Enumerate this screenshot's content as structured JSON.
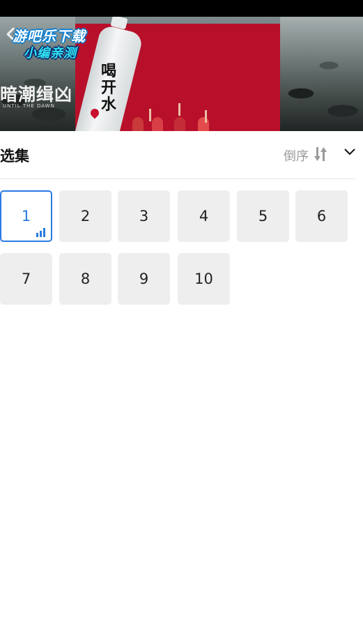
{
  "video": {
    "logo_line1": "游吧乐下载",
    "logo_line2": "小编亲测",
    "watermark": "暗潮缉凶",
    "watermark_sub": "UNTIL THE DAWN",
    "ad_text": "喝开水"
  },
  "episodes_panel": {
    "title": "选集",
    "sort_label": "倒序",
    "accent_color": "#2a7ae2",
    "episodes": [
      {
        "label": "1",
        "active": true
      },
      {
        "label": "2",
        "active": false
      },
      {
        "label": "3",
        "active": false
      },
      {
        "label": "4",
        "active": false
      },
      {
        "label": "5",
        "active": false
      },
      {
        "label": "6",
        "active": false
      },
      {
        "label": "7",
        "active": false
      },
      {
        "label": "8",
        "active": false
      },
      {
        "label": "9",
        "active": false
      },
      {
        "label": "10",
        "active": false
      }
    ]
  }
}
